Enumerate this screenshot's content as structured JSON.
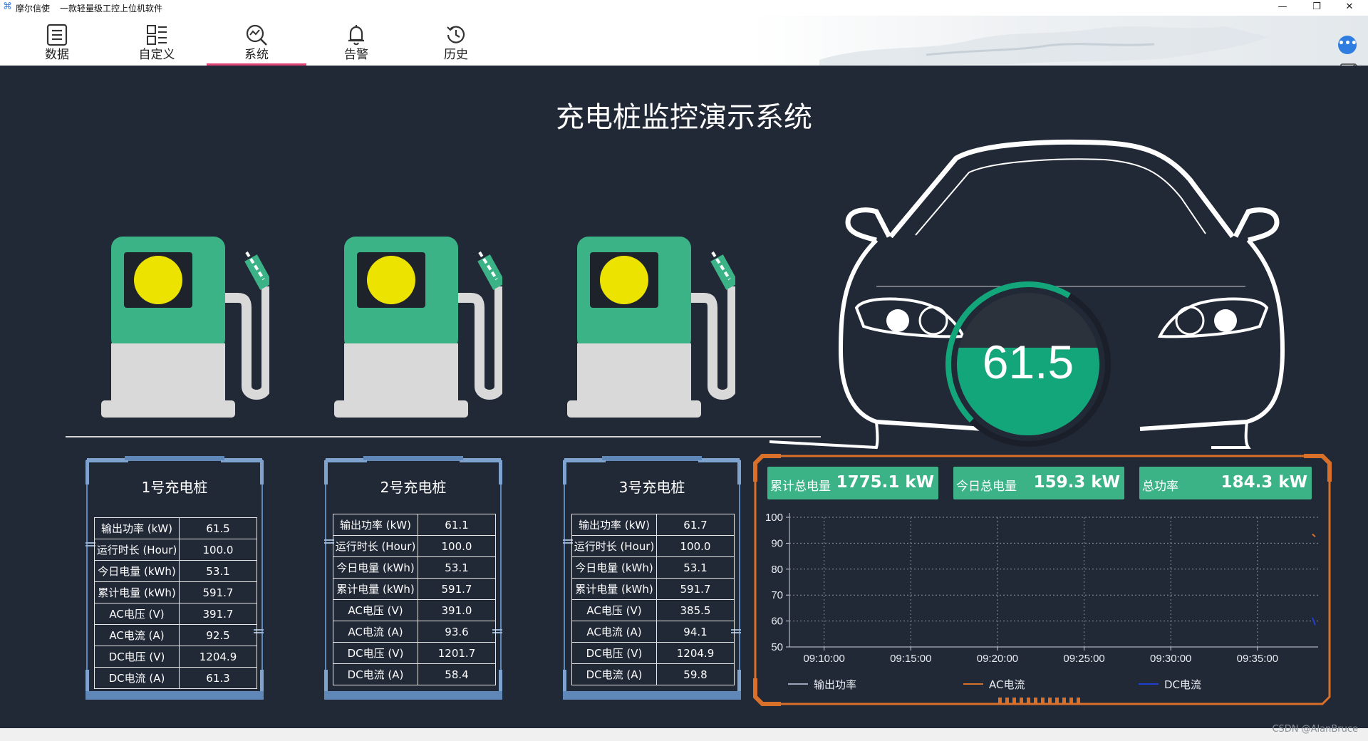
{
  "window": {
    "app_name": "摩尔信使",
    "subtitle": "一款轻量级工控上位机软件",
    "minimize_glyph": "—",
    "restore_glyph": "❐",
    "close_glyph": "✕"
  },
  "toolbar": {
    "items": [
      {
        "label": "数据",
        "icon": "document-icon"
      },
      {
        "label": "自定义",
        "icon": "layout-grid-icon"
      },
      {
        "label": "系统",
        "icon": "analytics-icon",
        "active": true
      },
      {
        "label": "告警",
        "icon": "bell-icon"
      },
      {
        "label": "历史",
        "icon": "history-icon"
      }
    ],
    "chat_glyph": "•••"
  },
  "dashboard": {
    "title": "充电桩监控演示系统",
    "gauge_value": "61.5",
    "gauge_fraction": 0.615,
    "colors": {
      "background": "#212836",
      "accent_green": "#3cb387",
      "gauge_teal": "#14a67b",
      "indicator_yellow": "#ece400",
      "panel_blue": "#5f87b8",
      "chart_frame_orange": "#d9702a"
    }
  },
  "stations": [
    {
      "title": "1号充电桩",
      "rows": [
        {
          "k": "输出功率 (kW)",
          "v": "61.5"
        },
        {
          "k": "运行时长 (Hour)",
          "v": "100.0"
        },
        {
          "k": "今日电量 (kWh)",
          "v": "53.1"
        },
        {
          "k": "累计电量 (kWh)",
          "v": "591.7"
        },
        {
          "k": "AC电压 (V)",
          "v": "391.7"
        },
        {
          "k": "AC电流 (A)",
          "v": "92.5"
        },
        {
          "k": "DC电压 (V)",
          "v": "1204.9"
        },
        {
          "k": "DC电流 (A)",
          "v": "61.3"
        }
      ]
    },
    {
      "title": "2号充电桩",
      "rows": [
        {
          "k": "输出功率 (kW)",
          "v": "61.1"
        },
        {
          "k": "运行时长 (Hour)",
          "v": "100.0"
        },
        {
          "k": "今日电量 (kWh)",
          "v": "53.1"
        },
        {
          "k": "累计电量 (kWh)",
          "v": "591.7"
        },
        {
          "k": "AC电压 (V)",
          "v": "391.0"
        },
        {
          "k": "AC电流 (A)",
          "v": "93.6"
        },
        {
          "k": "DC电压 (V)",
          "v": "1201.7"
        },
        {
          "k": "DC电流 (A)",
          "v": "58.4"
        }
      ]
    },
    {
      "title": "3号充电桩",
      "rows": [
        {
          "k": "输出功率 (kW)",
          "v": "61.7"
        },
        {
          "k": "运行时长 (Hour)",
          "v": "100.0"
        },
        {
          "k": "今日电量 (kWh)",
          "v": "53.1"
        },
        {
          "k": "累计电量 (kWh)",
          "v": "591.7"
        },
        {
          "k": "AC电压 (V)",
          "v": "385.5"
        },
        {
          "k": "AC电流 (A)",
          "v": "94.1"
        },
        {
          "k": "DC电压 (V)",
          "v": "1204.9"
        },
        {
          "k": "DC电流 (A)",
          "v": "59.8"
        }
      ]
    }
  ],
  "stats": [
    {
      "label": "累计总电量",
      "value": "1775.1 kW"
    },
    {
      "label": "今日总电量",
      "value": "159.3 kW"
    },
    {
      "label": "总功率",
      "value": "184.3 kW"
    }
  ],
  "chart_data": {
    "type": "line",
    "title": "",
    "ylim": [
      50,
      100
    ],
    "yticks": [
      "100",
      "90",
      "80",
      "70",
      "60",
      "50"
    ],
    "xticks": [
      "09:10:00",
      "09:15:00",
      "09:20:00",
      "09:25:00",
      "09:30:00",
      "09:35:00"
    ],
    "x_range": [
      "09:08:00",
      "09:38:30"
    ],
    "grid": true,
    "legend_position": "bottom",
    "series": [
      {
        "name": "输出功率",
        "color": "#9aa4b8",
        "x": [],
        "y": []
      },
      {
        "name": "AC电流",
        "color": "#d9702a",
        "x": [
          "09:38:10",
          "09:38:20"
        ],
        "y": [
          93.5,
          92.5
        ]
      },
      {
        "name": "DC电流",
        "color": "#1f3fcf",
        "x": [
          "09:38:10",
          "09:38:20"
        ],
        "y": [
          61.3,
          58.4
        ]
      }
    ]
  },
  "footer": {
    "credit": "CSDN @AlanBruce"
  }
}
